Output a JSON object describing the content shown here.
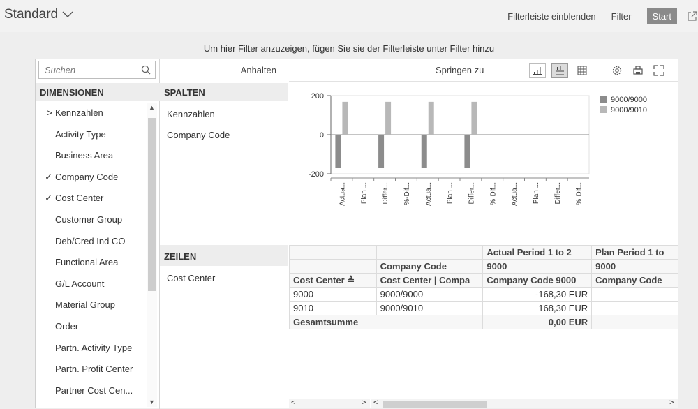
{
  "header": {
    "variant": "Standard",
    "show_filterbar": "Filterleiste einblenden",
    "filter": "Filter",
    "start": "Start"
  },
  "filter_hint": "Um hier Filter anzuzeigen, fügen Sie sie der Filterleiste unter Filter hinzu",
  "dimensions": {
    "search_placeholder": "Suchen",
    "header": "DIMENSIONEN",
    "items": [
      {
        "mark": ">",
        "label": "Kennzahlen"
      },
      {
        "mark": "",
        "label": "Activity Type"
      },
      {
        "mark": "",
        "label": "Business Area"
      },
      {
        "mark": "✓",
        "label": "Company Code"
      },
      {
        "mark": "✓",
        "label": "Cost Center"
      },
      {
        "mark": "",
        "label": "Customer Group"
      },
      {
        "mark": "",
        "label": "Deb/Cred Ind CO"
      },
      {
        "mark": "",
        "label": "Functional Area"
      },
      {
        "mark": "",
        "label": "G/L Account"
      },
      {
        "mark": "",
        "label": "Material Group"
      },
      {
        "mark": "",
        "label": "Order"
      },
      {
        "mark": "",
        "label": "Partn. Activity Type"
      },
      {
        "mark": "",
        "label": "Partn. Profit Center"
      },
      {
        "mark": "",
        "label": "Partner Cost Cen..."
      }
    ]
  },
  "columns": {
    "pause": "Anhalten",
    "header": "SPALTEN",
    "items": [
      "Kennzahlen",
      "Company Code"
    ],
    "rows_header": "ZEILEN",
    "row_items": [
      "Cost Center"
    ]
  },
  "content_toolbar": {
    "jump_to": "Springen zu"
  },
  "chart_data": {
    "type": "bar",
    "categories": [
      "Actua...",
      "Plan ...",
      "Differ...",
      "%-Dif...",
      "Actua...",
      "Plan ...",
      "Differ...",
      "%-Dif...",
      "Actua...",
      "Plan ...",
      "Differ...",
      "%-Dif..."
    ],
    "series": [
      {
        "name": "9000/9000",
        "values": [
          -168.3,
          0,
          -168.3,
          0,
          -168.3,
          0,
          -168.3,
          0,
          0,
          0,
          0,
          0
        ],
        "color": "#8c8c8c"
      },
      {
        "name": "9000/9010",
        "values": [
          168.3,
          0,
          168.3,
          0,
          168.3,
          0,
          168.3,
          0,
          0,
          0,
          0,
          0
        ],
        "color": "#b8b8b8"
      }
    ],
    "yticks": [
      "200",
      "0",
      "-200"
    ],
    "ylim": [
      -200,
      200
    ],
    "legend": "top-right"
  },
  "table": {
    "header_row1": [
      "",
      "",
      "Actual Period 1 to 2",
      "Plan Period 1 to"
    ],
    "header_row2": [
      "",
      "Company Code",
      "9000",
      "9000"
    ],
    "header_row3": [
      "Cost Center ≜",
      "Cost Center | Compa",
      "Company Code 9000",
      "Company Code"
    ],
    "rows": [
      [
        "9000",
        "9000/9000",
        "-168,30 EUR",
        ""
      ],
      [
        "9010",
        "9000/9010",
        "168,30 EUR",
        ""
      ]
    ],
    "total": [
      "Gesamtsumme",
      "0,00 EUR"
    ]
  }
}
